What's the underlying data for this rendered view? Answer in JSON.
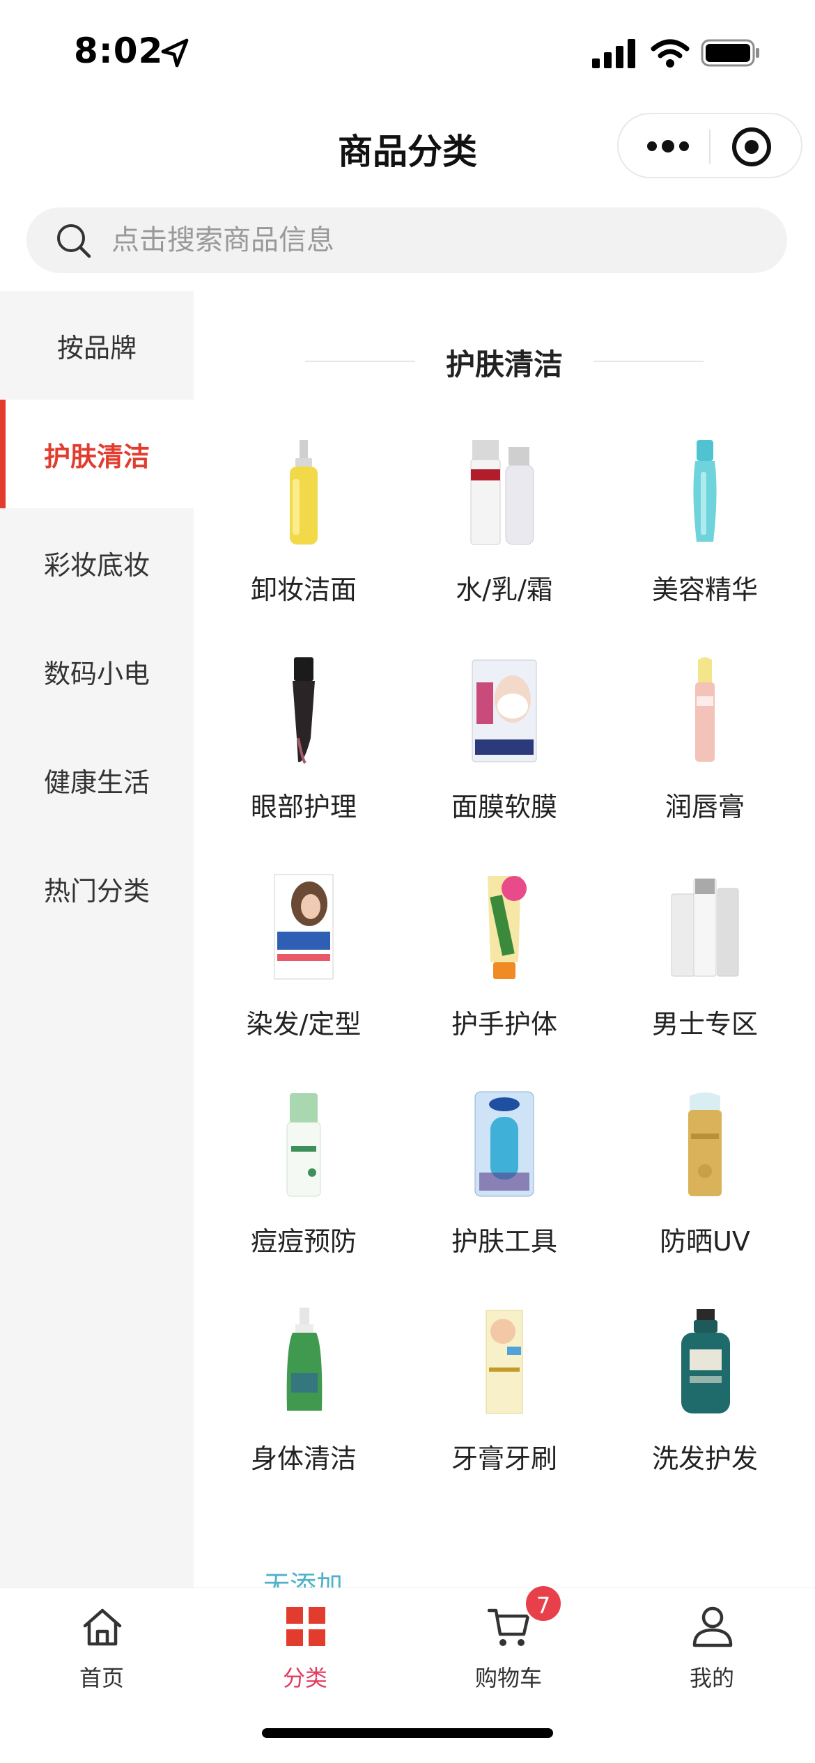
{
  "status_bar": {
    "time": "8:02"
  },
  "nav": {
    "title": "商品分类"
  },
  "search": {
    "placeholder": "点击搜索商品信息"
  },
  "sidebar": {
    "items": [
      {
        "label": "按品牌",
        "active": false
      },
      {
        "label": "护肤清洁",
        "active": true
      },
      {
        "label": "彩妆底妆",
        "active": false
      },
      {
        "label": "数码小电",
        "active": false
      },
      {
        "label": "健康生活",
        "active": false
      },
      {
        "label": "热门分类",
        "active": false
      }
    ]
  },
  "content": {
    "section_title": "护肤清洁",
    "categories": [
      {
        "label": "卸妆洁面",
        "icon": "cleansing-oil-bottle-icon"
      },
      {
        "label": "水/乳/霜",
        "icon": "lotion-bottles-icon"
      },
      {
        "label": "美容精华",
        "icon": "serum-bottle-icon"
      },
      {
        "label": "眼部护理",
        "icon": "eye-cream-tube-icon"
      },
      {
        "label": "面膜软膜",
        "icon": "face-mask-pack-icon"
      },
      {
        "label": "润唇膏",
        "icon": "lip-balm-icon"
      },
      {
        "label": "染发/定型",
        "icon": "hair-dye-box-icon"
      },
      {
        "label": "护手护体",
        "icon": "hand-cream-tube-icon"
      },
      {
        "label": "男士专区",
        "icon": "mens-skincare-icon"
      },
      {
        "label": "痘痘预防",
        "icon": "acne-care-bottle-icon"
      },
      {
        "label": "护肤工具",
        "icon": "skincare-tool-icon"
      },
      {
        "label": "防晒UV",
        "icon": "sunscreen-bottle-icon"
      },
      {
        "label": "身体清洁",
        "icon": "body-wash-bottle-icon"
      },
      {
        "label": "牙膏牙刷",
        "icon": "toothpaste-box-icon"
      },
      {
        "label": "洗发护发",
        "icon": "shampoo-bottle-icon"
      }
    ],
    "next_section_peek": "无添加"
  },
  "tabbar": {
    "tabs": [
      {
        "label": "首页",
        "icon": "home-icon",
        "active": false
      },
      {
        "label": "分类",
        "icon": "category-grid-icon",
        "active": true
      },
      {
        "label": "购物车",
        "icon": "cart-icon",
        "active": false,
        "badge": "7"
      },
      {
        "label": "我的",
        "icon": "profile-icon",
        "active": false
      }
    ]
  },
  "colors": {
    "accent": "#e23c2e",
    "tab_active": "#e23c5e",
    "badge": "#e8404a",
    "sidebar_bg": "#f5f5f5"
  }
}
